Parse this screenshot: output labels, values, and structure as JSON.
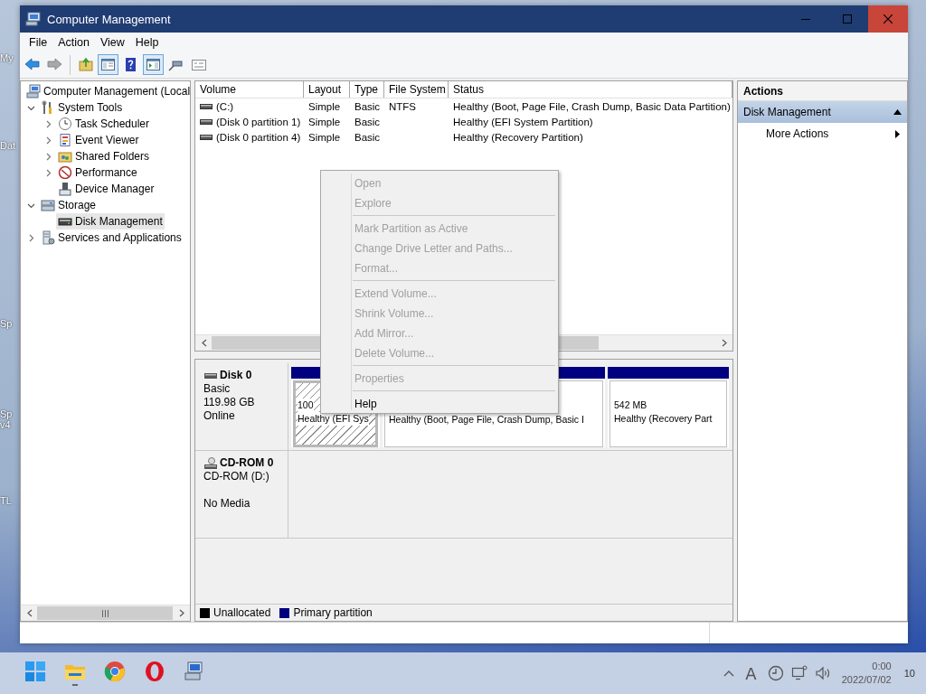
{
  "desktop_icons": [
    {
      "lines": [
        "My"
      ]
    },
    {
      "lines": [
        "Dat"
      ]
    },
    {
      "lines": [
        "Sp"
      ]
    },
    {
      "lines": [
        "Sp",
        "v4"
      ]
    },
    {
      "lines": [
        "TL"
      ]
    }
  ],
  "window": {
    "title": "Computer Management"
  },
  "menu_bar": [
    "File",
    "Action",
    "View",
    "Help"
  ],
  "toolbar": [
    {
      "pressed": false
    },
    {
      "pressed": false
    },
    {
      "pressed": false
    },
    {
      "pressed": true
    },
    {
      "pressed": false
    },
    {
      "pressed": true
    },
    {
      "pressed": false
    },
    {
      "pressed": false
    }
  ],
  "tree": [
    {
      "label": "Computer Management (Local",
      "selected": false,
      "children": [
        {
          "label": "System Tools",
          "expanded": true,
          "selected": false,
          "children": [
            {
              "label": "Task Scheduler",
              "expanded": false,
              "selected": false
            },
            {
              "label": "Event Viewer",
              "expanded": false,
              "selected": false
            },
            {
              "label": "Shared Folders",
              "expanded": false,
              "selected": false
            },
            {
              "label": "Performance",
              "expanded": false,
              "selected": false
            },
            {
              "label": "Device Manager",
              "selected": false
            }
          ]
        },
        {
          "label": "Storage",
          "expanded": true,
          "selected": false,
          "children": [
            {
              "label": "Disk Management",
              "selected": true
            }
          ]
        },
        {
          "label": "Services and Applications",
          "expanded": false,
          "selected": false
        }
      ]
    }
  ],
  "volume_list": {
    "columns": [
      "Volume",
      "Layout",
      "Type",
      "File System",
      "Status"
    ],
    "rows": [
      [
        "(C:)",
        "Simple",
        "Basic",
        "NTFS",
        "Healthy (Boot, Page File, Crash Dump, Basic Data Partition)"
      ],
      [
        "(Disk 0 partition 1)",
        "Simple",
        "Basic",
        "",
        "Healthy (EFI System Partition)"
      ],
      [
        "(Disk 0 partition 4)",
        "Simple",
        "Basic",
        "",
        "Healthy (Recovery Partition)"
      ]
    ]
  },
  "disks": [
    {
      "kind": "disk",
      "name": "Disk 0",
      "lines": [
        "Basic",
        "119.98 GB",
        "Online"
      ],
      "partitions": [
        {
          "size": "100",
          "status": "Healthy (EFI Sys",
          "selected": true
        },
        {
          "status": "Healthy (Boot, Page File, Crash Dump, Basic I",
          "selected": false
        },
        {
          "size": "542 MB",
          "status": "Healthy (Recovery Part",
          "selected": false
        }
      ]
    },
    {
      "kind": "cdrom",
      "name": "CD-ROM 0",
      "lines": [
        "CD-ROM (D:)",
        "No Media"
      ]
    }
  ],
  "legend": [
    {
      "label": "Unallocated",
      "color": "#000000"
    },
    {
      "label": "Primary partition",
      "color": "#000080"
    }
  ],
  "context_menu": [
    {
      "kind": "item",
      "label": "Open",
      "disabled": true
    },
    {
      "kind": "item",
      "label": "Explore",
      "disabled": true
    },
    {
      "kind": "separator"
    },
    {
      "kind": "item",
      "label": "Mark Partition as Active",
      "disabled": true
    },
    {
      "kind": "item",
      "label": "Change Drive Letter and Paths...",
      "disabled": true
    },
    {
      "kind": "item",
      "label": "Format...",
      "disabled": true
    },
    {
      "kind": "separator"
    },
    {
      "kind": "item",
      "label": "Extend Volume...",
      "disabled": true
    },
    {
      "kind": "item",
      "label": "Shrink Volume...",
      "disabled": true
    },
    {
      "kind": "item",
      "label": "Add Mirror...",
      "disabled": true
    },
    {
      "kind": "item",
      "label": "Delete Volume...",
      "disabled": true
    },
    {
      "kind": "separator"
    },
    {
      "kind": "item",
      "label": "Properties",
      "disabled": true
    },
    {
      "kind": "separator"
    },
    {
      "kind": "item",
      "label": "Help",
      "disabled": false
    }
  ],
  "actions": {
    "title": "Actions",
    "sections": [
      {
        "label": "Disk Management",
        "expanded": true,
        "items": [
          "More Actions"
        ]
      }
    ]
  },
  "taskbar": {
    "apps": [
      {
        "running": false
      },
      {
        "running": true
      },
      {
        "running": false
      },
      {
        "running": false
      },
      {
        "running": false
      }
    ],
    "ime": "A",
    "time": "0:00",
    "date": "2022/07/02",
    "notifications": "10"
  }
}
